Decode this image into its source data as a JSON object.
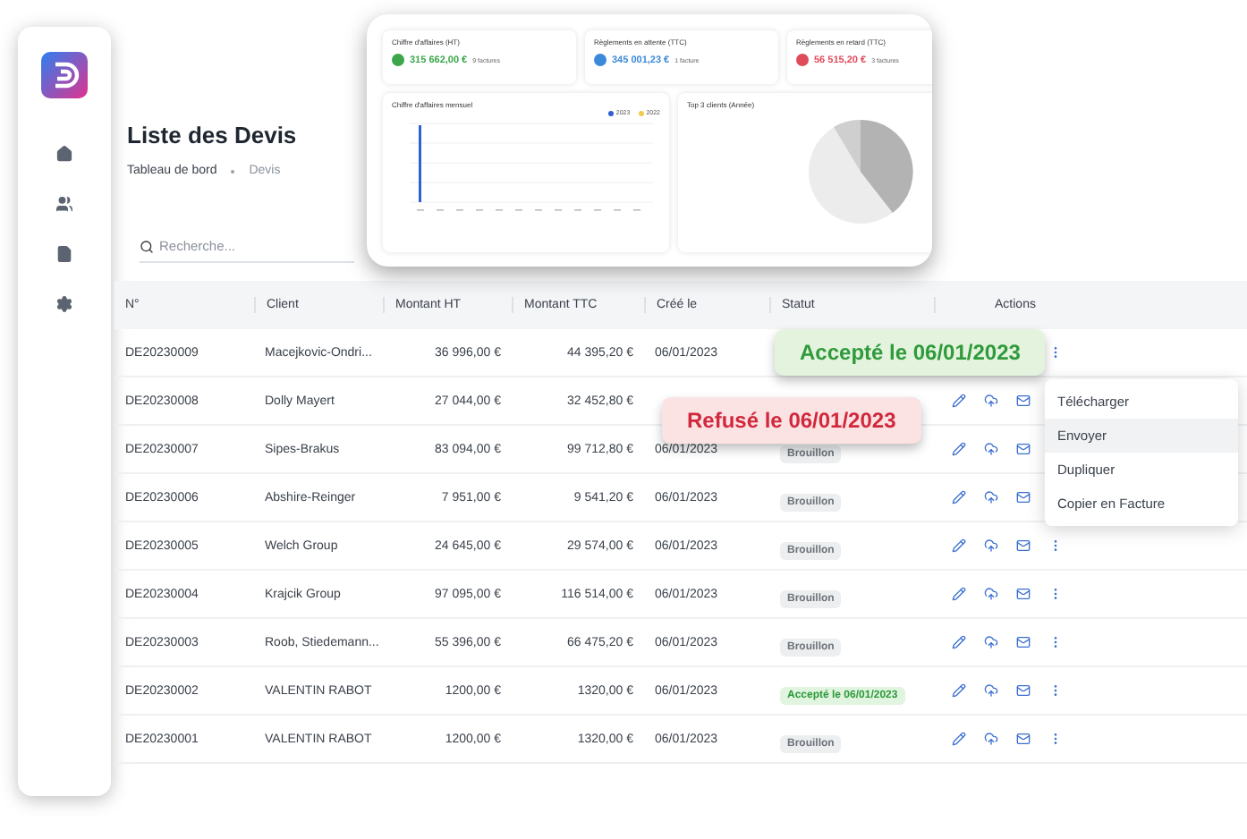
{
  "sidebar": {
    "items": [
      {
        "kind": "home",
        "selected": false
      },
      {
        "kind": "users",
        "selected": false
      },
      {
        "kind": "file",
        "selected": false
      },
      {
        "kind": "settings",
        "selected": false
      }
    ]
  },
  "page": {
    "title": "Liste des Devis",
    "breadcrumb": [
      "Tableau de bord",
      "Devis"
    ]
  },
  "search": {
    "placeholder": "Recherche..."
  },
  "table": {
    "columns": [
      "N°",
      "Client",
      "Montant HT",
      "Montant TTC",
      "Créé le",
      "Statut",
      "Actions"
    ],
    "rows": [
      {
        "number": "DE20230009",
        "client": "Macejkovic-Ondri...",
        "ht": "36 996,00 €",
        "ttc": "44 395,20 €",
        "created": "06/01/2023"
      },
      {
        "number": "DE20230008",
        "client": "Dolly Mayert",
        "ht": "27 044,00 €",
        "ttc": "32 452,80 €"
      },
      {
        "number": "DE20230007",
        "client": "Sipes-Brakus",
        "ht": "83 094,00 €",
        "ttc": "99 712,80 €",
        "created": "06/01/2023",
        "status": {
          "kind": "draft",
          "label": "Brouillon"
        }
      },
      {
        "number": "DE20230006",
        "client": "Abshire-Reinger",
        "ht": "7 951,00 €",
        "ttc": "9 541,20 €",
        "created": "06/01/2023",
        "status": {
          "kind": "draft",
          "label": "Brouillon"
        }
      },
      {
        "number": "DE20230005",
        "client": "Welch Group",
        "ht": "24 645,00 €",
        "ttc": "29 574,00 €",
        "created": "06/01/2023",
        "status": {
          "kind": "draft",
          "label": "Brouillon"
        }
      },
      {
        "number": "DE20230004",
        "client": "Krajcik Group",
        "ht": "97 095,00 €",
        "ttc": "116 514,00 €",
        "created": "06/01/2023",
        "status": {
          "kind": "draft",
          "label": "Brouillon"
        }
      },
      {
        "number": "DE20230003",
        "client": "Roob, Stiedemann...",
        "ht": "55 396,00 €",
        "ttc": "66 475,20 €",
        "created": "06/01/2023",
        "status": {
          "kind": "draft",
          "label": "Brouillon"
        }
      },
      {
        "number": "DE20230002",
        "client": "VALENTIN RABOT",
        "ht": "1200,00 €",
        "ttc": "1320,00 €",
        "created": "06/01/2023",
        "status": {
          "kind": "accepted",
          "label": "Accepté le 06/01/2023"
        }
      },
      {
        "number": "DE20230001",
        "client": "VALENTIN RABOT",
        "ht": "1200,00 €",
        "ttc": "1320,00 €",
        "created": "06/01/2023",
        "status": {
          "kind": "draft",
          "label": "Brouillon"
        }
      }
    ]
  },
  "dashboard": {
    "kpis": [
      {
        "title": "Chiffre d'affaires (HT)",
        "value": "315 662,00 €",
        "count": "9 factures",
        "color": "#3ba74a"
      },
      {
        "title": "Règlements en attente (TTC)",
        "value": "345 001,23 €",
        "count": "1 facture",
        "color": "#3b8ad9"
      },
      {
        "title": "Règlements en retard (TTC)",
        "value": "56 515,20 €",
        "count": "3 factures",
        "color": "#e04b5a"
      }
    ],
    "monthly_chart": {
      "title": "Chiffre d'affaires mensuel",
      "legend": [
        {
          "label": "2023",
          "color": "#2f5fd0"
        },
        {
          "label": "2022",
          "color": "#f2c94c"
        }
      ]
    },
    "pie_chart": {
      "title": "Top 3 clients (Année)"
    }
  },
  "callouts": [
    {
      "kind": "accepted",
      "label": "Accepté le 06/01/2023"
    },
    {
      "kind": "refused",
      "label": "Refusé le 06/01/2023"
    }
  ],
  "menu": {
    "items": [
      {
        "label": "Télécharger",
        "selected": false
      },
      {
        "label": "Envoyer",
        "selected": true
      },
      {
        "label": "Dupliquer",
        "selected": false
      },
      {
        "label": "Copier en Facture",
        "selected": false
      }
    ]
  }
}
